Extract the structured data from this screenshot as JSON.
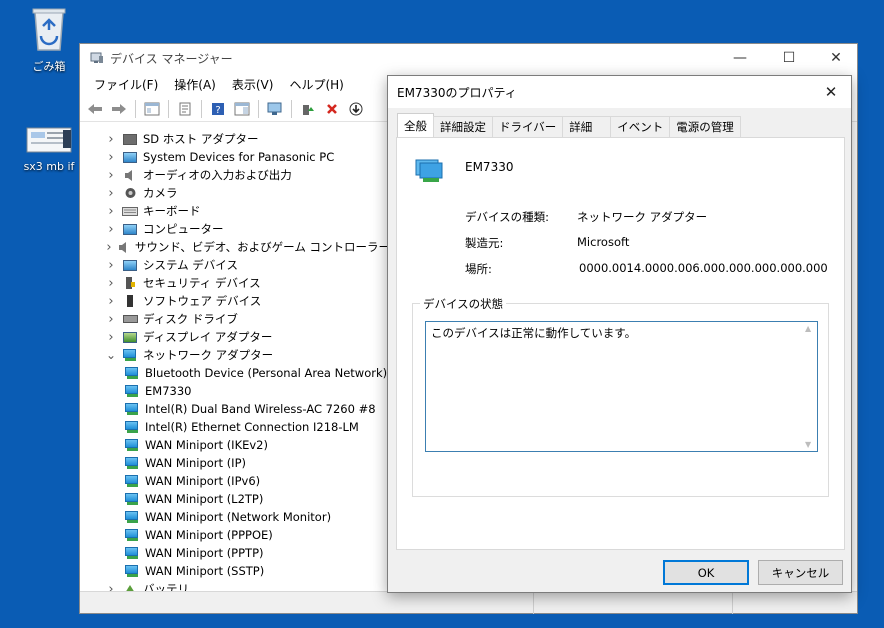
{
  "desktop": {
    "icons": [
      {
        "label": "ごみ箱"
      },
      {
        "label": "sx3 mb if"
      }
    ]
  },
  "device_manager": {
    "title": "デバイス マネージャー",
    "controls": {
      "minimize": "—",
      "maximize": "☐",
      "close": "✕"
    },
    "menu": [
      "ファイル(F)",
      "操作(A)",
      "表示(V)",
      "ヘルプ(H)"
    ],
    "tree": [
      {
        "label": "SD ホスト アダプター",
        "icon": "sd-host-icon",
        "expanded": false,
        "level": 0
      },
      {
        "label": "System Devices for Panasonic PC",
        "icon": "system-device-icon",
        "expanded": false,
        "level": 0
      },
      {
        "label": "オーディオの入力および出力",
        "icon": "speaker-icon",
        "expanded": false,
        "level": 0
      },
      {
        "label": "カメラ",
        "icon": "camera-icon",
        "expanded": false,
        "level": 0
      },
      {
        "label": "キーボード",
        "icon": "keyboard-icon",
        "expanded": false,
        "level": 0
      },
      {
        "label": "コンピューター",
        "icon": "computer-icon",
        "expanded": false,
        "level": 0
      },
      {
        "label": "サウンド、ビデオ、およびゲーム コントローラー",
        "icon": "speaker-icon",
        "expanded": false,
        "level": 0
      },
      {
        "label": "システム デバイス",
        "icon": "system-device-icon",
        "expanded": false,
        "level": 0
      },
      {
        "label": "セキュリティ デバイス",
        "icon": "security-device-icon",
        "expanded": false,
        "level": 0
      },
      {
        "label": "ソフトウェア デバイス",
        "icon": "software-device-icon",
        "expanded": false,
        "level": 0
      },
      {
        "label": "ディスク ドライブ",
        "icon": "disk-drive-icon",
        "expanded": false,
        "level": 0
      },
      {
        "label": "ディスプレイ アダプター",
        "icon": "display-adapter-icon",
        "expanded": false,
        "level": 0
      },
      {
        "label": "ネットワーク アダプター",
        "icon": "network-adapter-icon",
        "expanded": true,
        "level": 0
      },
      {
        "label": "Bluetooth Device (Personal Area Network)",
        "icon": "network-adapter-icon",
        "level": 1
      },
      {
        "label": "EM7330",
        "icon": "network-adapter-icon",
        "level": 1
      },
      {
        "label": "Intel(R) Dual Band Wireless-AC 7260 #8",
        "icon": "network-adapter-icon",
        "level": 1
      },
      {
        "label": "Intel(R) Ethernet Connection I218-LM",
        "icon": "network-adapter-icon",
        "level": 1
      },
      {
        "label": "WAN Miniport (IKEv2)",
        "icon": "network-adapter-icon",
        "level": 1
      },
      {
        "label": "WAN Miniport (IP)",
        "icon": "network-adapter-icon",
        "level": 1
      },
      {
        "label": "WAN Miniport (IPv6)",
        "icon": "network-adapter-icon",
        "level": 1
      },
      {
        "label": "WAN Miniport (L2TP)",
        "icon": "network-adapter-icon",
        "level": 1
      },
      {
        "label": "WAN Miniport (Network Monitor)",
        "icon": "network-adapter-icon",
        "level": 1
      },
      {
        "label": "WAN Miniport (PPPOE)",
        "icon": "network-adapter-icon",
        "level": 1
      },
      {
        "label": "WAN Miniport (PPTP)",
        "icon": "network-adapter-icon",
        "level": 1
      },
      {
        "label": "WAN Miniport (SSTP)",
        "icon": "network-adapter-icon",
        "level": 1
      },
      {
        "label": "バッテリ",
        "icon": "battery-icon",
        "expanded": false,
        "level": 0
      }
    ]
  },
  "properties_dialog": {
    "title": "EM7330のプロパティ",
    "close": "✕",
    "tabs": [
      "全般",
      "詳細設定",
      "ドライバー",
      "詳細",
      "イベント",
      "電源の管理"
    ],
    "active_tab": 0,
    "device_name": "EM7330",
    "properties": [
      {
        "label": "デバイスの種類:",
        "value": "ネットワーク アダプター"
      },
      {
        "label": "製造元:",
        "value": "Microsoft"
      },
      {
        "label": "場所:",
        "value": "0000.0014.0000.006.000.000.000.000.000"
      }
    ],
    "status_group_title": "デバイスの状態",
    "status_text": "このデバイスは正常に動作しています。",
    "ok_label": "OK",
    "cancel_label": "キャンセル"
  }
}
